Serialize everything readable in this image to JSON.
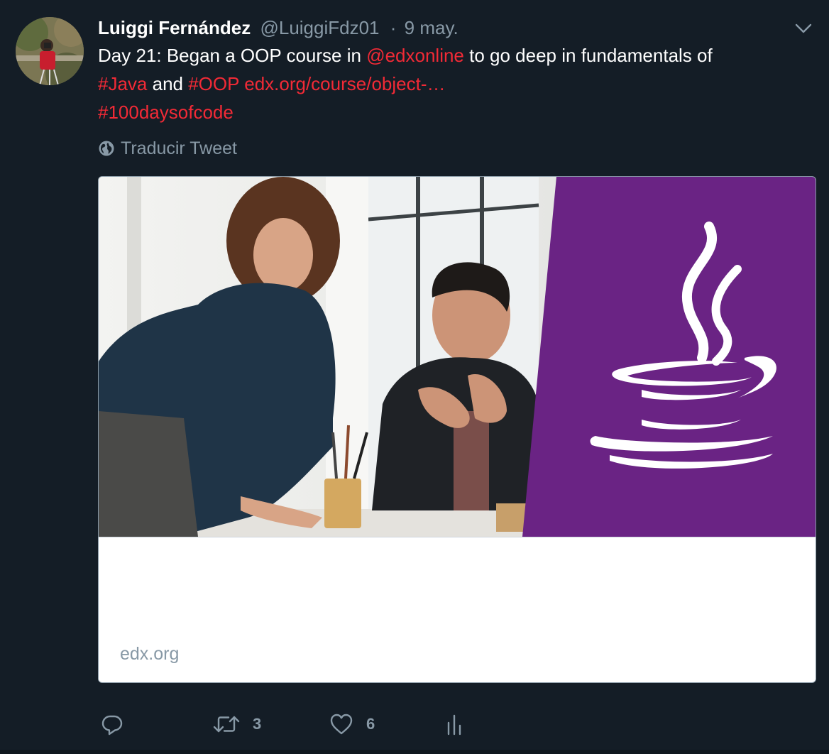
{
  "tweet": {
    "author": {
      "display_name": "Luiggi Fernández",
      "handle": "@LuiggiFdz01",
      "avatar_icon": "user-avatar-photo"
    },
    "separator": "·",
    "time": "9 may.",
    "text": {
      "line1_prefix": "Day 21: Began a OOP course in ",
      "mention": "@edxonline",
      "line1_suffix": " to go deep in fundamentals of",
      "hashtag_java": "#Java",
      "word_and": " and ",
      "hashtag_oop": "#OOP",
      "space": " ",
      "url": "edx.org/course/object-…",
      "hashtag_100days": "#100daysofcode"
    },
    "translate_label": "Traducir Tweet",
    "card": {
      "domain": "edx.org",
      "image_icon": "java-coffee-cup-logo"
    },
    "actions": {
      "reply_count": "",
      "retweet_count": "3",
      "like_count": "6"
    }
  },
  "colors": {
    "background": "#141d26",
    "link": "#f22a36",
    "muted": "#8899a6",
    "java_purple": "#6a2384"
  }
}
